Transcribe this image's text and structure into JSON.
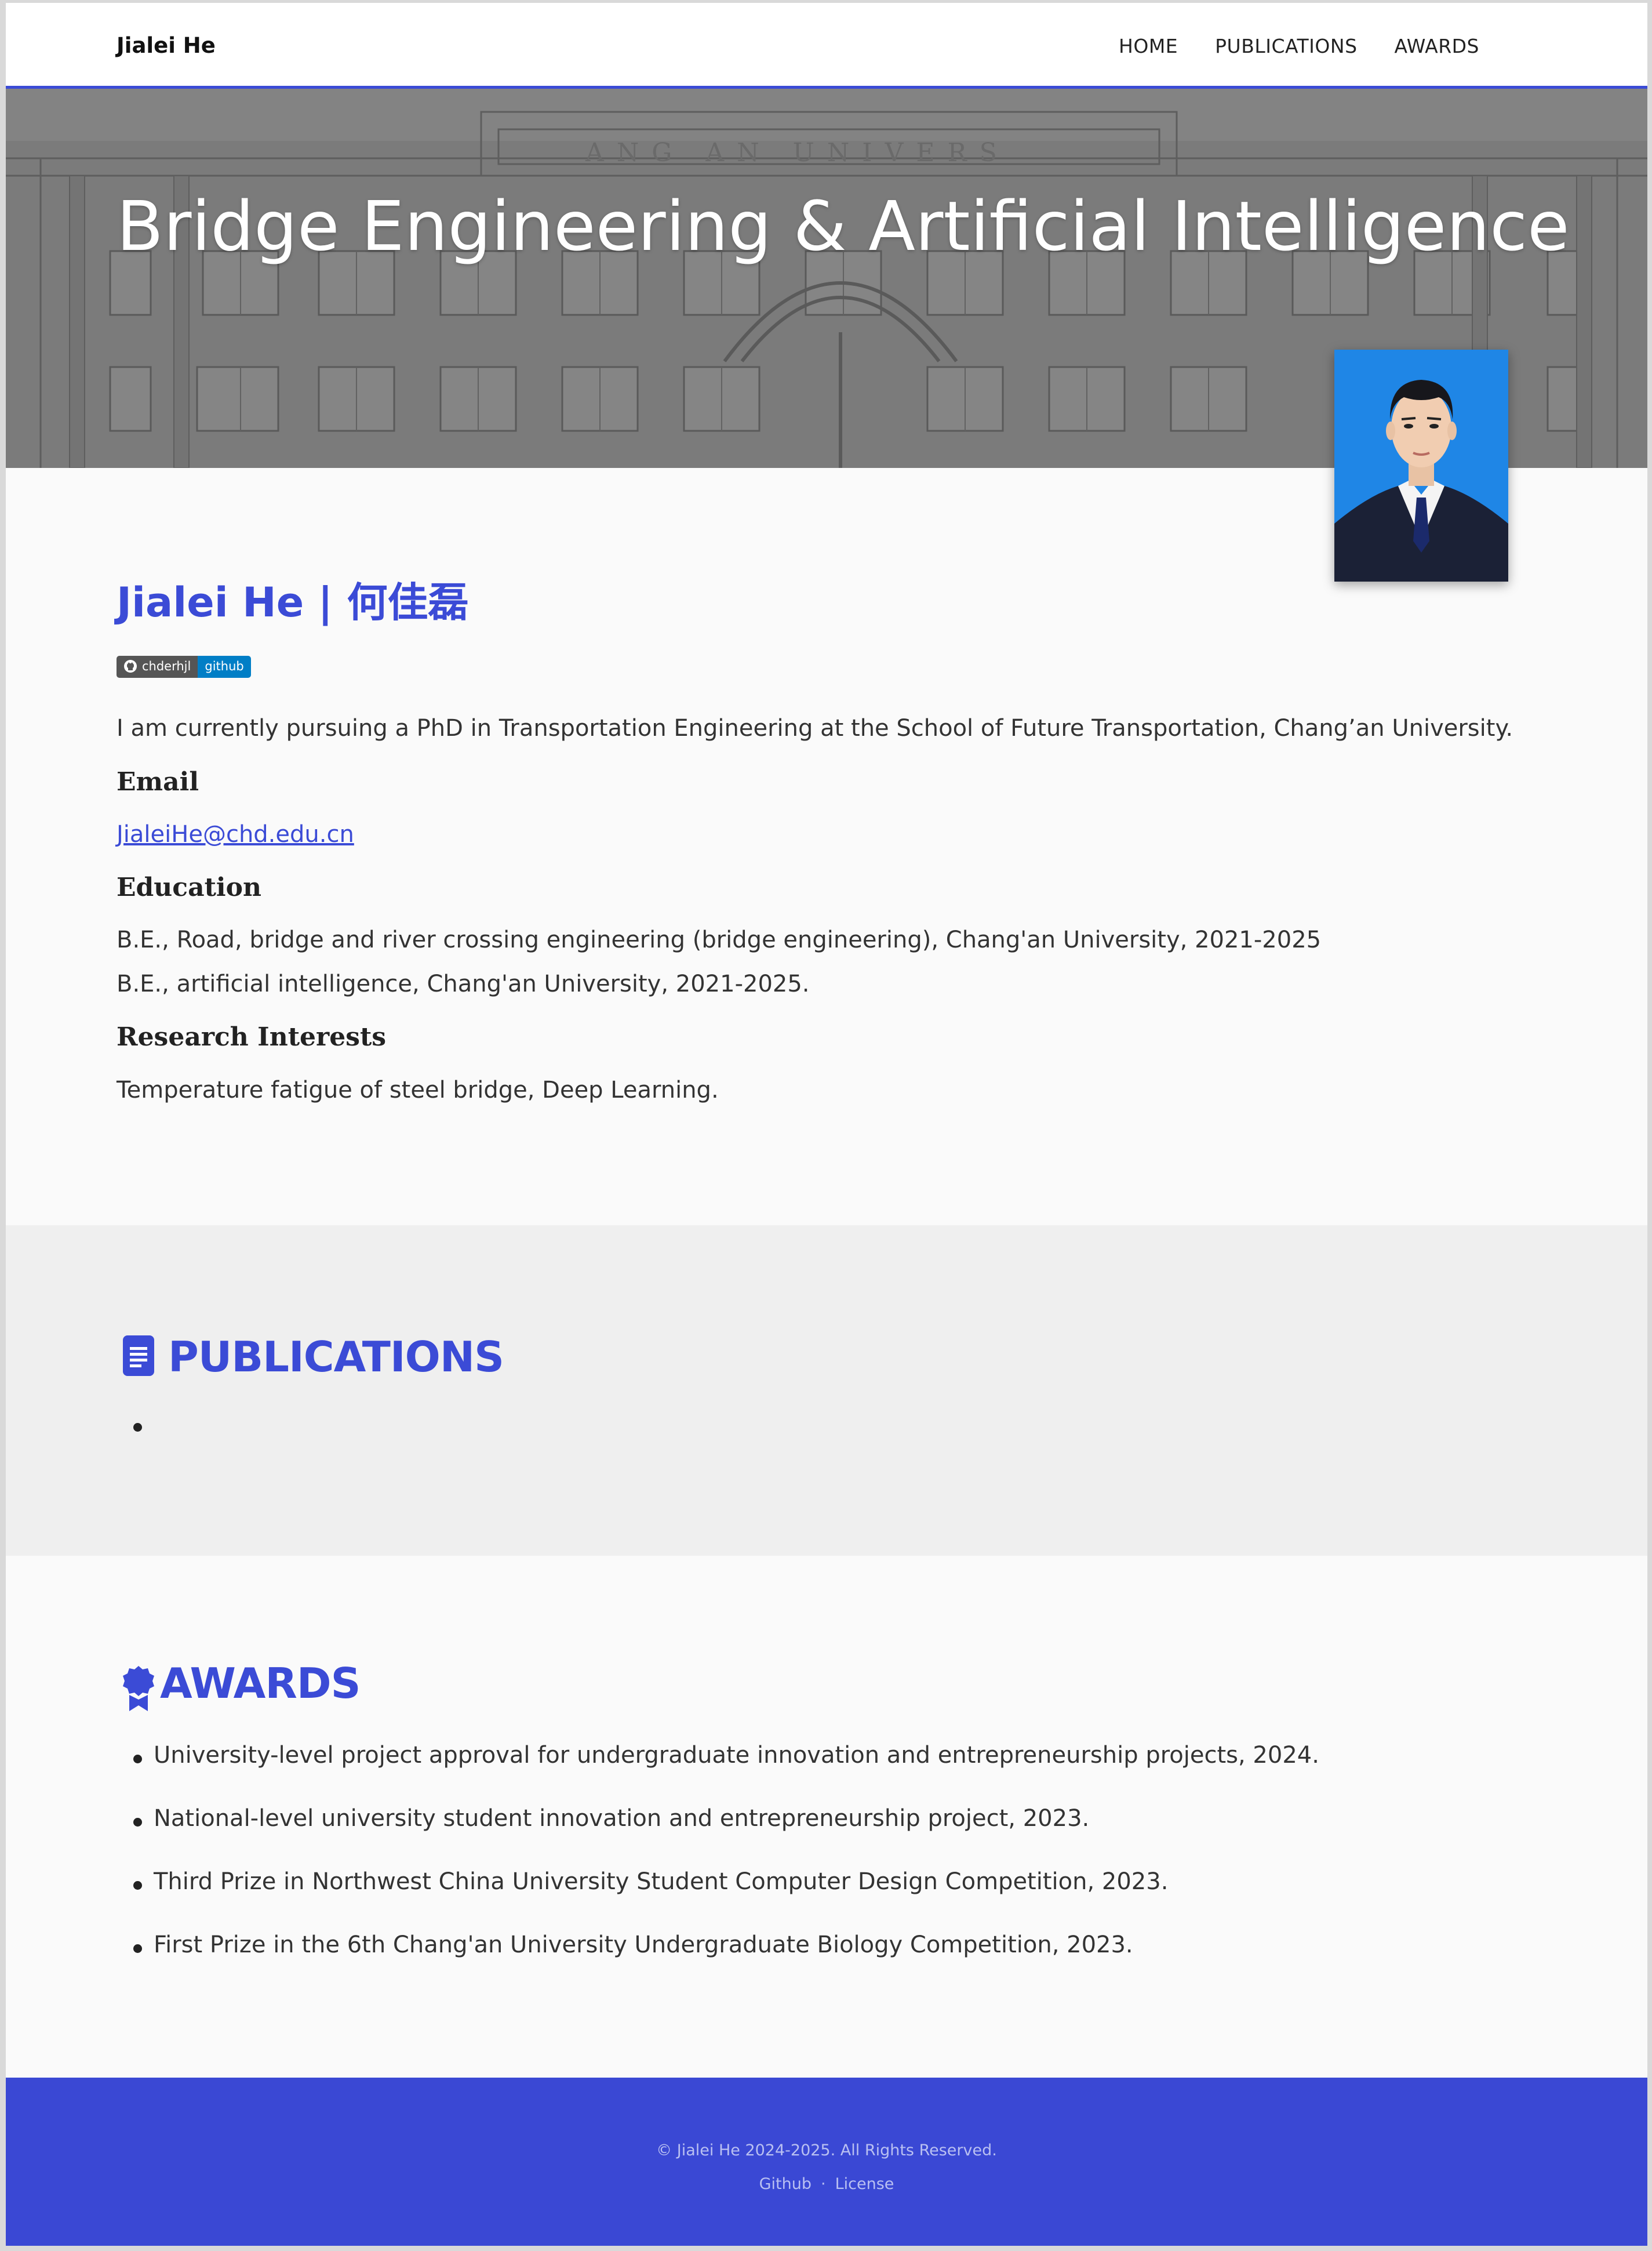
{
  "navbar": {
    "brand": "Jialei He",
    "links": [
      "HOME",
      "PUBLICATIONS",
      "AWARDS"
    ]
  },
  "hero": {
    "title": "Bridge Engineering & Artificial Intelligence",
    "building_sign": "ANG AN UNIVERS"
  },
  "about": {
    "name": "Jialei He | 何佳磊",
    "badge": {
      "user": "chderhjl",
      "service": "github"
    },
    "intro": "I am currently pursuing a PhD in Transportation Engineering at the School of Future Transportation, Chang’an University.",
    "email_heading": "Email",
    "email": "JialeiHe@chd.edu.cn",
    "education_heading": "Education",
    "education": [
      "B.E., Road, bridge and river crossing engineering (bridge engineering), Chang'an University, 2021-2025",
      "B.E., artificial intelligence, Chang'an University, 2021-2025."
    ],
    "research_heading": "Research Interests",
    "research": "Temperature fatigue of steel bridge, Deep Learning."
  },
  "publications": {
    "title": "PUBLICATIONS",
    "items": [
      ""
    ]
  },
  "awards": {
    "title": "AWARDS",
    "items": [
      "University-level project approval for undergraduate innovation and entrepreneurship projects, 2024.",
      "National-level university student innovation and entrepreneurship project, 2023.",
      "Third Prize in Northwest China University Student Computer Design Competition, 2023.",
      "First Prize in the 6th Chang'an University Undergraduate Biology Competition, 2023."
    ]
  },
  "footer": {
    "copyright": "© Jialei He 2024-2025. All Rights Reserved.",
    "links": [
      "Github",
      "License"
    ],
    "separator": "·"
  },
  "colors": {
    "accent": "#3b4bd6",
    "footer_bg": "#3a48d4",
    "badge_service": "#007ec6",
    "portrait_bg": "#1f86e6"
  },
  "icons": {
    "publications": "document-icon",
    "awards": "award-ribbon-icon",
    "badge": "github-icon"
  }
}
